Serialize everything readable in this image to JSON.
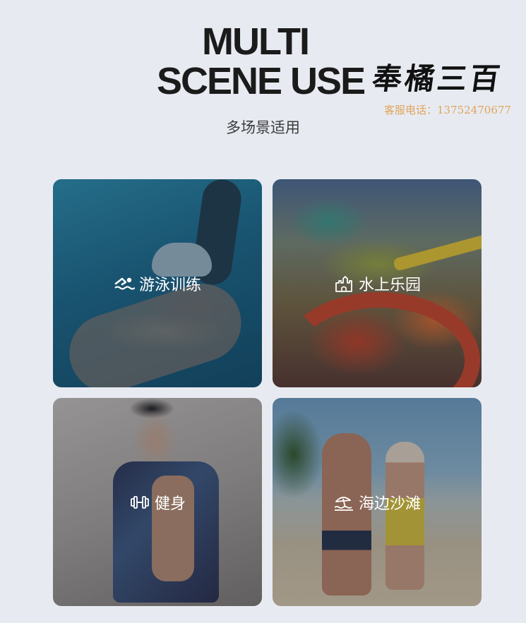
{
  "header": {
    "title_line1": "MULTI",
    "title_line2": "SCENE USE",
    "subtitle": "多场景适用"
  },
  "brand": {
    "logo_text": "奉橘三百",
    "contact": "客服电话：13752470677"
  },
  "cards": [
    {
      "label": "游泳训练",
      "icon": "swimming-icon"
    },
    {
      "label": "水上乐园",
      "icon": "castle-icon"
    },
    {
      "label": "健身",
      "icon": "dumbbell-icon"
    },
    {
      "label": "海边沙滩",
      "icon": "beach-umbrella-icon"
    }
  ],
  "colors": {
    "background": "#e7ebf1",
    "title": "#1b1b1b",
    "contact": "#e2a35a",
    "card_text": "#ffffff"
  }
}
